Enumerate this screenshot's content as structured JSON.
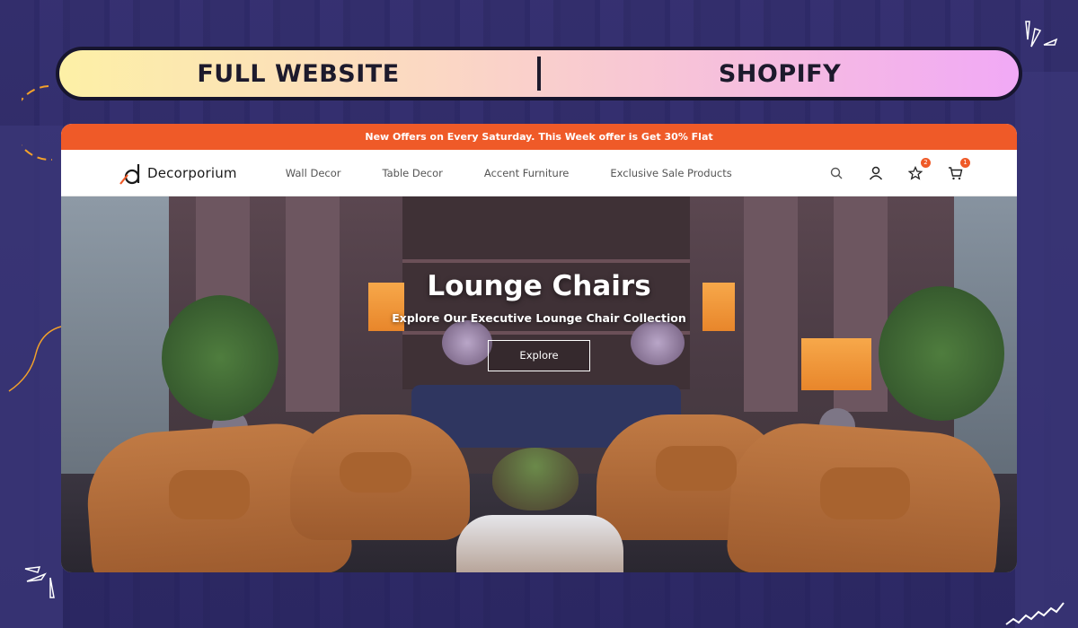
{
  "banner": {
    "left_label": "FULL WEBSITE",
    "right_label": "SHOPIFY"
  },
  "site": {
    "offer_text": "New Offers on Every Saturday. This Week offer is Get 30% Flat",
    "brand": "Decorporium",
    "nav": [
      {
        "label": "Wall Decor"
      },
      {
        "label": "Table Decor"
      },
      {
        "label": "Accent Furniture"
      },
      {
        "label": "Exclusive Sale Products"
      }
    ],
    "icons": {
      "search": "search-icon",
      "account": "user-icon",
      "wishlist": "star-icon",
      "cart": "cart-icon"
    },
    "wishlist_count": "2",
    "cart_count": "1",
    "accent_color": "#ef5a28",
    "hero": {
      "title": "Lounge Chairs",
      "subtitle": "Explore Our Executive Lounge Chair Collection",
      "button_label": "Explore"
    }
  }
}
